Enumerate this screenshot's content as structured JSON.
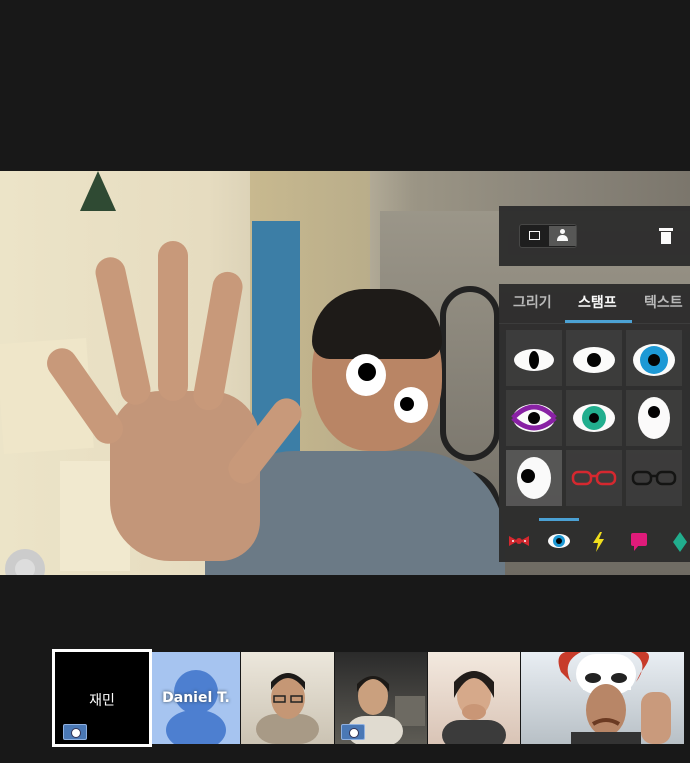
{
  "toolbar": {
    "mode_options": [
      "frame-icon",
      "person-icon"
    ],
    "selected_mode": "person-icon",
    "trash_icon": "trash-icon"
  },
  "sticker_panel": {
    "tabs": [
      {
        "label": "그리기"
      },
      {
        "label": "스탬프"
      },
      {
        "label": "텍스트"
      }
    ],
    "active_tab": "스탬프",
    "accent_color": "#4aa3d8",
    "stickers": [
      "almond-eye",
      "round-eye",
      "blue-ring-eye",
      "purple-ring-eye",
      "teal-ring-eye",
      "oval-eye",
      "big-eye",
      "red-glasses",
      "black-glasses"
    ],
    "selected_sticker": "big-eye",
    "categories": [
      "bowtie-icon",
      "eye-icon",
      "lightning-icon",
      "speech-bubble-icon",
      "gem-icon"
    ],
    "selected_category": "eye-icon"
  },
  "participants": [
    {
      "name": "재민",
      "self": true,
      "camera_badge": true
    },
    {
      "name": "Daniel T.",
      "camera_badge": false
    },
    {
      "name": "",
      "camera_badge": false
    },
    {
      "name": "",
      "camera_badge": true
    },
    {
      "name": "",
      "camera_badge": false
    },
    {
      "name": "",
      "camera_badge": false
    }
  ]
}
